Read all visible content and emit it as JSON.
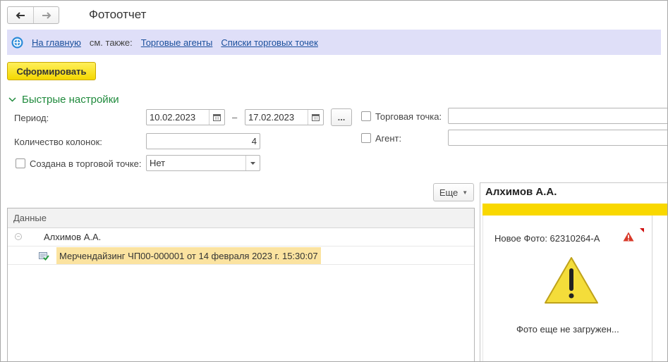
{
  "window": {
    "title": "Фотоотчет"
  },
  "nav": {
    "back_icon": "arrow-left-icon",
    "forward_icon": "arrow-right-icon"
  },
  "linkbar": {
    "home_icon": "home-icon",
    "home_link": "На главную",
    "see_also": "см. также:",
    "links": [
      "Торговые агенты",
      "Списки торговых точек"
    ]
  },
  "toolbar": {
    "generate_label": "Сформировать"
  },
  "quick_settings": {
    "title": "Быстрые настройки",
    "period_label": "Период:",
    "period_from": "10.02.2023",
    "period_dash": "–",
    "period_to": "17.02.2023",
    "period_choose": "...",
    "columns_label": "Количество колонок:",
    "columns_value": "4",
    "created_label": "Создана в торговой точке:",
    "created_checked": false,
    "created_value": "Нет",
    "trade_point_label": "Торговая точка:",
    "trade_point_checked": false,
    "trade_point_value": "",
    "agent_label": "Агент:",
    "agent_checked": false,
    "agent_value": ""
  },
  "more_button": {
    "label": "Еще"
  },
  "tree": {
    "header": "Данные",
    "group": "Алхимов А.А.",
    "item": "Мерчендайзинг ЧП00-000001 от 14 февраля 2023 г. 15:30:07"
  },
  "photo": {
    "title": "Алхимов А.А.",
    "new_photo": "Новое Фото: 62310264-А",
    "status": "Фото еще не загружен...",
    "accent": "#f9d800"
  },
  "colors": {
    "accent_link": "#1a4f9c",
    "section_green": "#1f8a3c",
    "linkbar_bg": "#dfdff8",
    "selected_row": "#fbe3a0",
    "button_yellow": "#f4d800"
  }
}
